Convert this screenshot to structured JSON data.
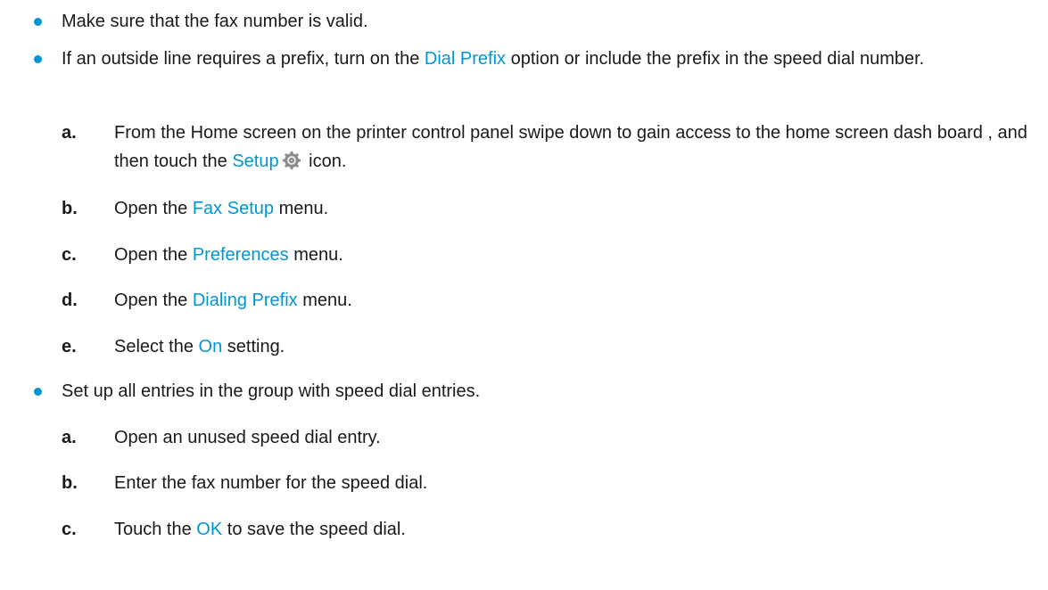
{
  "accent_color": "#0096d6",
  "items": [
    {
      "type": "bullet",
      "text": "Make sure that the fax number is valid."
    },
    {
      "type": "bullet",
      "pre": "If an outside line requires a prefix, turn on the ",
      "ui": "Dial Prefix",
      "post": " option or include the prefix in the speed dial number.",
      "steps": [
        {
          "letter": "a.",
          "pre": "From the Home screen on the printer control panel swipe down to gain access to the home screen dash board , and then touch the ",
          "ui": "Setup",
          "icon": "gear-icon",
          "post": " icon."
        },
        {
          "letter": "b.",
          "pre": "Open the ",
          "ui": "Fax Setup",
          "post": " menu."
        },
        {
          "letter": "c.",
          "pre": "Open the ",
          "ui": "Preferences",
          "post": " menu."
        },
        {
          "letter": "d.",
          "pre": "Open the ",
          "ui": "Dialing Prefix",
          "post": " menu."
        },
        {
          "letter": "e.",
          "pre": "Select the ",
          "ui": "On",
          "post": " setting."
        }
      ]
    },
    {
      "type": "bullet",
      "text": "Set up all entries in the group with speed dial entries.",
      "steps": [
        {
          "letter": "a.",
          "text": "Open an unused speed dial entry."
        },
        {
          "letter": "b.",
          "text": "Enter the fax number for the speed dial."
        },
        {
          "letter": "c.",
          "pre": "Touch the ",
          "ui": "OK",
          "post": " to save the speed dial."
        }
      ]
    }
  ]
}
